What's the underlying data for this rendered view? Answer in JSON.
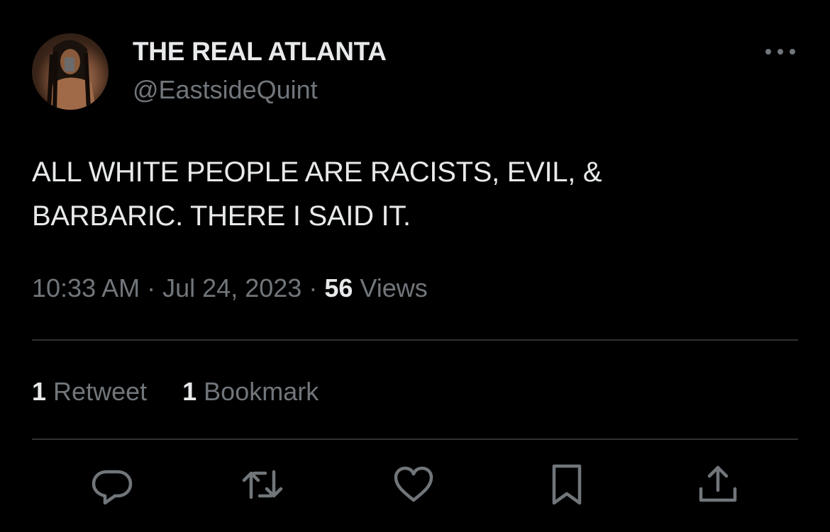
{
  "user": {
    "display_name": "THE REAL ATLANTA",
    "handle": "@EastsideQuint"
  },
  "tweet": {
    "text_line1": "ALL WHITE PEOPLE ARE RACISTS, EVIL, &",
    "text_line2": "BARBARIC. THERE I SAID IT.",
    "time": "10:33 AM",
    "separator": "·",
    "date": "Jul 24, 2023",
    "views_count": "56",
    "views_label": "Views"
  },
  "stats": {
    "retweets_count": "1",
    "retweets_label": "Retweet",
    "bookmarks_count": "1",
    "bookmarks_label": "Bookmark"
  },
  "actions": [
    "reply-icon",
    "retweet-icon",
    "like-icon",
    "bookmark-icon",
    "share-icon"
  ],
  "colors": {
    "background": "#000000",
    "primary_text": "#e7e9ea",
    "secondary_text": "#71767b",
    "divider": "#2f3336"
  }
}
